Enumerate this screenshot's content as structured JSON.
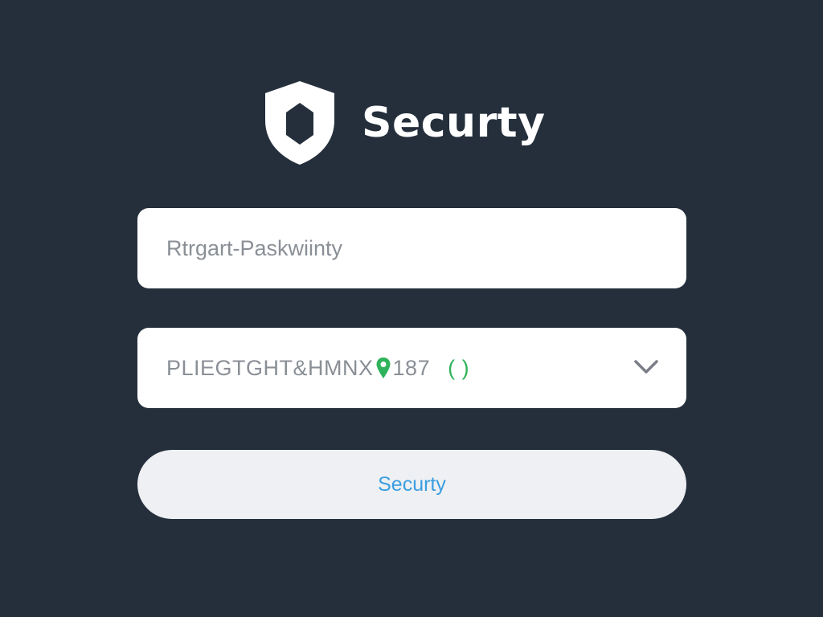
{
  "brand": {
    "title": "Securty",
    "icon": "shield-icon",
    "icon_color": "#ffffff"
  },
  "password_field": {
    "placeholder": "Rtrgart-Paskwiinty"
  },
  "select_field": {
    "value_text": "PLIEGTGHT&HMNX",
    "value_icon": "location-pin-icon",
    "value_icon_color": "#2fb35a",
    "value_number": "187",
    "value_brackets": "( )",
    "dropdown_icon": "chevron-down-icon"
  },
  "submit_button": {
    "label": "Securty",
    "label_color": "#3a9ee0"
  },
  "colors": {
    "background": "#252f3c",
    "field_background": "#ffffff",
    "button_background": "#eef0f3"
  }
}
